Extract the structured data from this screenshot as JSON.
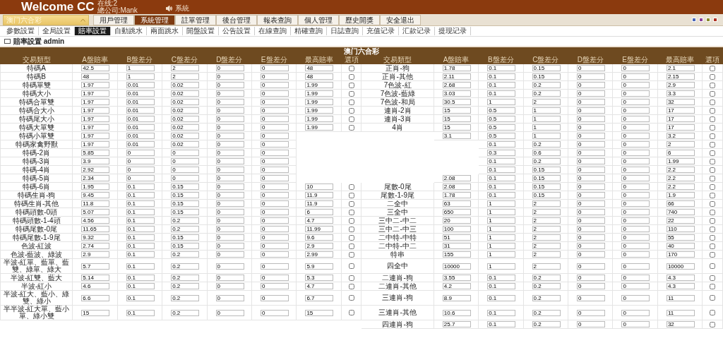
{
  "header": {
    "title": "Welcome CC",
    "online": "在线:2",
    "company": "總公司:Mank",
    "sound": "系統"
  },
  "lottery_select": {
    "value": "澳门六合彩"
  },
  "menu": [
    {
      "label": "用戶管理",
      "selected": false
    },
    {
      "label": "系統管理",
      "selected": true
    },
    {
      "label": "註單管理",
      "selected": false
    },
    {
      "label": "後台管理",
      "selected": false
    },
    {
      "label": "報表查詢",
      "selected": false
    },
    {
      "label": "個人管理",
      "selected": false
    },
    {
      "label": "歷史開獎",
      "selected": false
    },
    {
      "label": "安全退出",
      "selected": false
    }
  ],
  "submenu": [
    {
      "label": "參數設置",
      "selected": false
    },
    {
      "label": "全局設置",
      "selected": false
    },
    {
      "label": "賠率設置",
      "selected": true
    },
    {
      "label": "自動跳水",
      "selected": false
    },
    {
      "label": "兩面跳水",
      "selected": false
    },
    {
      "label": "開盤設置",
      "selected": false
    },
    {
      "label": "公告設置",
      "selected": false
    },
    {
      "label": "在線查詢",
      "selected": false
    },
    {
      "label": "精確查詢",
      "selected": false
    },
    {
      "label": "日誌查詢",
      "selected": false
    },
    {
      "label": "充值记录",
      "selected": false
    },
    {
      "label": "汇款记录",
      "selected": false
    },
    {
      "label": "提现记录",
      "selected": false
    }
  ],
  "page_title": "賠率設置 admin",
  "table": {
    "title": "澳门六合彩",
    "left_columns": [
      "交易類型",
      "A盤賠率",
      "B盤差分",
      "C盤差分",
      "D盤差分",
      "E盤差分",
      "最高賠率",
      "選項"
    ],
    "right_columns": [
      "交易類型",
      "A盤賠率",
      "B盤差分",
      "C盤差分",
      "D盤差分",
      "E盤差分",
      "最高賠率",
      "選項"
    ],
    "rows": [
      {
        "left": {
          "name": "特碼A",
          "a": "42.5",
          "b": "1",
          "c": "2",
          "d": "0",
          "e": "0",
          "max": "48",
          "checked": false
        },
        "right": {
          "name": "正肖-狗",
          "a": "1.78",
          "b": "0.1",
          "c": "0.15",
          "d": "0",
          "e": "0",
          "max": "2.1",
          "checked": false
        }
      },
      {
        "left": {
          "name": "特碼B",
          "a": "48",
          "b": "1",
          "c": "2",
          "d": "0",
          "e": "0",
          "max": "48",
          "checked": false
        },
        "right": {
          "name": "正肖-其他",
          "a": "2.11",
          "b": "0.1",
          "c": "0.15",
          "d": "0",
          "e": "0",
          "max": "2.15",
          "checked": false
        }
      },
      {
        "left": {
          "name": "特碼單雙",
          "a": "1.97",
          "b": "0.01",
          "c": "0.02",
          "d": "0",
          "e": "0",
          "max": "1.99",
          "checked": false
        },
        "right": {
          "name": "7色波-紅",
          "a": "2.68",
          "b": "0.1",
          "c": "0.2",
          "d": "0",
          "e": "0",
          "max": "2.9",
          "checked": false
        }
      },
      {
        "left": {
          "name": "特碼大小",
          "a": "1.97",
          "b": "0.01",
          "c": "0.02",
          "d": "0",
          "e": "0",
          "max": "1.99",
          "checked": false
        },
        "right": {
          "name": "7色波-藍綠",
          "a": "3.03",
          "b": "0.1",
          "c": "0.2",
          "d": "0",
          "e": "0",
          "max": "3.3",
          "checked": false
        }
      },
      {
        "left": {
          "name": "特碼合單雙",
          "a": "1.97",
          "b": "0.01",
          "c": "0.02",
          "d": "0",
          "e": "0",
          "max": "1.99",
          "checked": false
        },
        "right": {
          "name": "7色波-和局",
          "a": "30.5",
          "b": "1",
          "c": "2",
          "d": "0",
          "e": "0",
          "max": "32",
          "checked": false
        }
      },
      {
        "left": {
          "name": "特碼合大小",
          "a": "1.97",
          "b": "0.01",
          "c": "0.02",
          "d": "0",
          "e": "0",
          "max": "1.99",
          "checked": false
        },
        "right": {
          "name": "連肖-2肖",
          "a": "15",
          "b": "0.5",
          "c": "1",
          "d": "0",
          "e": "0",
          "max": "17",
          "checked": false
        }
      },
      {
        "left": {
          "name": "特碼尾大小",
          "a": "1.97",
          "b": "0.01",
          "c": "0.02",
          "d": "0",
          "e": "0",
          "max": "1.99",
          "checked": false
        },
        "right": {
          "name": "連肖-3肖",
          "a": "15",
          "b": "0.5",
          "c": "1",
          "d": "0",
          "e": "0",
          "max": "17",
          "checked": false
        }
      },
      {
        "left": {
          "name": "特碼大單雙",
          "a": "1.97",
          "b": "0.01",
          "c": "0.02",
          "d": "0",
          "e": "0",
          "max": "1.99",
          "checked": false
        },
        "right": {
          "name": "4肖",
          "a": "15",
          "b": "0.5",
          "c": "1",
          "d": "0",
          "e": "0",
          "max": "17",
          "checked": false
        }
      },
      {
        "left": {
          "name": "特碼小單雙",
          "a": "1.97",
          "b": "0.01",
          "c": "0.02",
          "d": "0",
          "e": "0"
        },
        "right": {
          "a": "3.1",
          "b": "0.5",
          "c": "1",
          "d": "0",
          "e": "0",
          "max": "3.2",
          "checked": false
        }
      },
      {
        "left": {
          "name": "特碼家禽野獸",
          "a": "1.97",
          "b": "0.01",
          "c": "0.02",
          "d": "0",
          "e": "0"
        },
        "right": {
          "b": "0.1",
          "c": "0.2",
          "d": "0",
          "e": "0",
          "max": "2",
          "checked": false
        }
      },
      {
        "left": {
          "name": "特碼-2肖",
          "a": "5.85",
          "b": "0",
          "c": "0",
          "d": "0",
          "e": "0"
        },
        "right": {
          "b": "0.3",
          "c": "0.6",
          "d": "0",
          "e": "0",
          "max": "6",
          "checked": false
        }
      },
      {
        "left": {
          "name": "特碼-3肖",
          "a": "3.9",
          "b": "0",
          "c": "0",
          "d": "0",
          "e": "0"
        },
        "right": {
          "b": "0.1",
          "c": "0.2",
          "d": "0",
          "e": "0",
          "max": "1.99",
          "checked": false
        }
      },
      {
        "left": {
          "name": "特碼-4肖",
          "a": "2.92",
          "b": "0",
          "c": "0",
          "d": "0",
          "e": "0"
        },
        "right": {
          "b": "0.1",
          "c": "0.15",
          "d": "0",
          "e": "0",
          "max": "2.2",
          "checked": false
        }
      },
      {
        "left": {
          "name": "特碼-5肖",
          "a": "2.34",
          "b": "0",
          "c": "0",
          "d": "0",
          "e": "0"
        },
        "right": {
          "a": "2.08",
          "b": "0.1",
          "c": "0.15",
          "d": "0",
          "e": "0",
          "max": "2.2",
          "checked": false
        }
      },
      {
        "left": {
          "name": "特碼-6肖",
          "a": "1.95",
          "b": "0.1",
          "c": "0.15",
          "d": "0",
          "e": "0",
          "max": "10",
          "checked": false
        },
        "right": {
          "name": "尾數-0尾",
          "a": "2.08",
          "b": "0.1",
          "c": "0.15",
          "d": "0",
          "e": "0",
          "max": "2.2",
          "checked": false
        }
      },
      {
        "left": {
          "name": "特碼生肖-狗",
          "a": "9.45",
          "b": "0.1",
          "c": "0.15",
          "d": "0",
          "e": "0",
          "max": "11.9",
          "checked": false
        },
        "right": {
          "name": "尾數-1-9尾",
          "a": "1.78",
          "b": "0.1",
          "c": "0.15",
          "d": "0",
          "e": "0",
          "max": "1.9",
          "checked": false
        }
      },
      {
        "left": {
          "name": "特碼生肖-其他",
          "a": "11.8",
          "b": "0.1",
          "c": "0.15",
          "d": "0",
          "e": "0",
          "max": "11.9",
          "checked": false
        },
        "right": {
          "name": "二全中",
          "a": "63",
          "b": "1",
          "c": "2",
          "d": "0",
          "e": "0",
          "max": "66",
          "checked": false
        }
      },
      {
        "left": {
          "name": "特碼頭數-0頭",
          "a": "5.07",
          "b": "0.1",
          "c": "0.15",
          "d": "0",
          "e": "0",
          "max": "6",
          "checked": false
        },
        "right": {
          "name": "三全中",
          "a": "650",
          "b": "1",
          "c": "2",
          "d": "0",
          "e": "0",
          "max": "740",
          "checked": false
        }
      },
      {
        "left": {
          "name": "特碼頭數-1-4頭",
          "a": "4.56",
          "b": "0.1",
          "c": "0.2",
          "d": "0",
          "e": "0",
          "max": "4.7",
          "checked": false
        },
        "right": {
          "name": "三中二-中二",
          "a": "20",
          "b": "1",
          "c": "2",
          "d": "0",
          "e": "0",
          "max": "22",
          "checked": false
        }
      },
      {
        "left": {
          "name": "特碼尾數-0尾",
          "a": "11.65",
          "b": "0.1",
          "c": "0.2",
          "d": "0",
          "e": "0",
          "max": "11.99",
          "checked": false
        },
        "right": {
          "name": "三中二-中三",
          "a": "100",
          "b": "1",
          "c": "2",
          "d": "0",
          "e": "0",
          "max": "110",
          "checked": false
        }
      },
      {
        "left": {
          "name": "特碼尾數-1-9尾",
          "a": "9.32",
          "b": "0.1",
          "c": "0.15",
          "d": "0",
          "e": "0",
          "max": "9.6",
          "checked": false
        },
        "right": {
          "name": "二中特-中特",
          "a": "51",
          "b": "1",
          "c": "2",
          "d": "0",
          "e": "0",
          "max": "55",
          "checked": false
        }
      },
      {
        "left": {
          "name": "色波-紅波",
          "a": "2.74",
          "b": "0.1",
          "c": "0.15",
          "d": "0",
          "e": "0",
          "max": "2.9",
          "checked": false
        },
        "right": {
          "name": "二中特-中二",
          "a": "31",
          "b": "1",
          "c": "2",
          "d": "0",
          "e": "0",
          "max": "40",
          "checked": false
        }
      },
      {
        "left": {
          "name": "色波-藍波、綠波",
          "a": "2.9",
          "b": "0.1",
          "c": "0.2",
          "d": "0",
          "e": "0",
          "max": "2.99",
          "checked": false
        },
        "right": {
          "name": "特串",
          "a": "155",
          "b": "1",
          "c": "2",
          "d": "0",
          "e": "0",
          "max": "170",
          "checked": false
        }
      },
      {
        "left": {
          "name": "半波-紅單、藍單、藍雙、綠單、綠大",
          "a": "5.7",
          "b": "0.1",
          "c": "0.2",
          "d": "0",
          "e": "0",
          "max": "5.9",
          "checked": false
        },
        "right": {
          "name": "四全中",
          "a": "10000",
          "b": "1",
          "c": "2",
          "d": "0",
          "e": "0",
          "max": "10000",
          "checked": false
        }
      },
      {
        "left": {
          "name": "半波-紅雙、藍大",
          "a": "5.14",
          "b": "0.1",
          "c": "0.2",
          "d": "0",
          "e": "0",
          "max": "5.3",
          "checked": false
        },
        "right": {
          "name": "二連肖-狗",
          "a": "3.55",
          "b": "0.1",
          "c": "0.2",
          "d": "0",
          "e": "0",
          "max": "4.3",
          "checked": false
        }
      },
      {
        "left": {
          "name": "半波-紅小",
          "a": "4.6",
          "b": "0.1",
          "c": "0.2",
          "d": "0",
          "e": "0",
          "max": "4.7",
          "checked": false
        },
        "right": {
          "name": "二連肖-其他",
          "a": "4.2",
          "b": "0.1",
          "c": "0.2",
          "d": "0",
          "e": "0",
          "max": "4.3",
          "checked": false
        }
      },
      {
        "left": {
          "name": "半波-紅大、藍小、綠雙、綠小",
          "a": "6.6",
          "b": "0.1",
          "c": "0.2",
          "d": "0",
          "e": "0",
          "max": "6.7",
          "checked": false
        },
        "right": {
          "name": "三連肖-狗",
          "a": "8.9",
          "b": "0.1",
          "c": "0.2",
          "d": "0",
          "e": "0",
          "max": "11",
          "checked": false
        }
      },
      {
        "left": {
          "name": "半半波-紅大單、藍小單、綠小雙",
          "a": "15",
          "b": "0.1",
          "c": "0.2",
          "d": "0",
          "e": "0",
          "max": "15",
          "checked": false
        },
        "right": {
          "name": "三連肖-其他",
          "a": "10.6",
          "b": "0.1",
          "c": "0.2",
          "d": "0",
          "e": "0",
          "max": "11",
          "checked": false
        }
      },
      {
        "right": {
          "name": "四連肖-狗",
          "a": "25.7",
          "b": "0.1",
          "c": "0.2",
          "d": "0",
          "e": "0",
          "max": "32",
          "checked": false
        }
      }
    ]
  }
}
